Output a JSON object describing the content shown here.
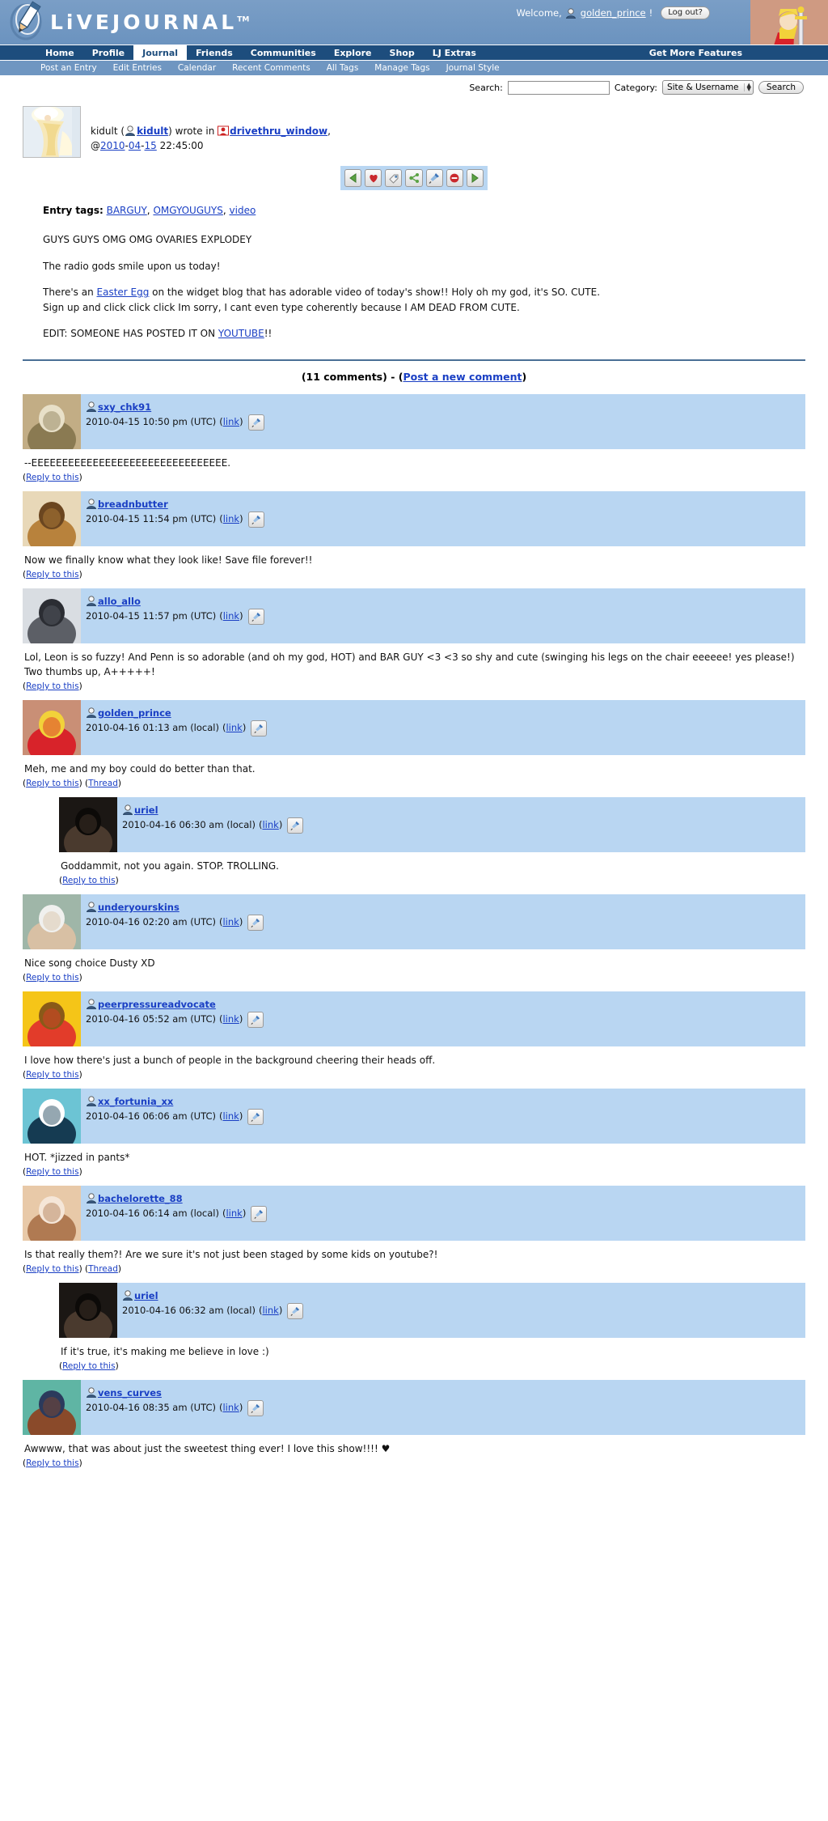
{
  "site": {
    "brand": "LiVEJOURNAL",
    "brand_tm": "TM",
    "logo_icon": "pencil-logo-icon"
  },
  "header": {
    "welcome_prefix": "Welcome,",
    "user_icon": "user-head-icon",
    "username": "golden_prince",
    "welcome_suffix": "!",
    "logout_label": "Log out?",
    "userpic_icon": "sword-in-stone-userpic"
  },
  "nav_main": {
    "items": [
      {
        "label": "Home",
        "active": false
      },
      {
        "label": "Profile",
        "active": false
      },
      {
        "label": "Journal",
        "active": true
      },
      {
        "label": "Friends",
        "active": false
      },
      {
        "label": "Communities",
        "active": false
      },
      {
        "label": "Explore",
        "active": false
      },
      {
        "label": "Shop",
        "active": false
      },
      {
        "label": "LJ Extras",
        "active": false
      }
    ],
    "right_label": "Get More Features"
  },
  "nav_sub": {
    "items": [
      {
        "label": "Post an Entry"
      },
      {
        "label": "Edit Entries"
      },
      {
        "label": "Calendar"
      },
      {
        "label": "Recent Comments"
      },
      {
        "label": "All Tags"
      },
      {
        "label": "Manage Tags"
      },
      {
        "label": "Journal Style"
      }
    ]
  },
  "search": {
    "label": "Search:",
    "value": "",
    "placeholder": "",
    "category_label": "Category:",
    "category_value": "Site & Username",
    "category_options": [
      "Site & Username"
    ],
    "button_label": "Search"
  },
  "entry": {
    "author_plain": "kidult",
    "author_open_paren": "(",
    "author_link": "kidult",
    "author_close_paren": ")",
    "wrote_in": "wrote in",
    "community": "drivethru_window",
    "comma": ",",
    "at_sign": "@",
    "date_year": "2010",
    "date_sep1": "-",
    "date_month": "04",
    "date_sep2": "-",
    "date_day": "15",
    "time": "22:45:00",
    "userpic_icon": "blonde-woman-userpic",
    "community_icon": "community-icon",
    "user_icon": "user-head-icon",
    "toolbar": [
      {
        "name": "previous-entry-button",
        "icon": "left-triangle-icon"
      },
      {
        "name": "add-to-memories-button",
        "icon": "heart-icon"
      },
      {
        "name": "tag-button",
        "icon": "tag-icon"
      },
      {
        "name": "share-button",
        "icon": "share-icon"
      },
      {
        "name": "edit-entry-button",
        "icon": "pin-edit-icon"
      },
      {
        "name": "block-button",
        "icon": "no-entry-icon"
      },
      {
        "name": "next-entry-button",
        "icon": "right-triangle-icon"
      }
    ],
    "tags_label": "Entry tags:",
    "tags": [
      "BARGUY",
      "OMGYOUGUYS",
      "video"
    ],
    "paragraphs": [
      {
        "parts": [
          {
            "t": "GUYS GUYS OMG OMG OVARIES EXPLODEY"
          }
        ]
      },
      {
        "parts": [
          {
            "t": "The radio gods smile upon us today!"
          }
        ]
      },
      {
        "parts": [
          {
            "t": "There's an "
          },
          {
            "t": "Easter Egg",
            "link": true
          },
          {
            "t": " on the widget blog that has adorable video of today's show!! Holy oh my god, it's SO. CUTE."
          },
          {
            "br": true
          },
          {
            "t": "Sign up and click click click Im sorry, I cant even type coherently because I AM DEAD FROM CUTE."
          }
        ]
      },
      {
        "parts": [
          {
            "t": "EDIT: SOMEONE HAS POSTED IT ON "
          },
          {
            "t": "YOUTUBE",
            "link": true
          },
          {
            "t": "!!"
          }
        ]
      }
    ]
  },
  "comments_header": {
    "count_text": "(11 comments)",
    "separator": "-",
    "post_open": "(",
    "post_label": "Post a new comment",
    "post_close": ")"
  },
  "comments": [
    {
      "level": 1,
      "username": "sxy_chk91",
      "date": "2010-04-15 10:50 pm (UTC)",
      "link_open": "(",
      "link_label": "link",
      "link_close": ")",
      "pin_icon": "pin-edit-icon",
      "userpic_icon": "medieval-woman-river-userpic",
      "userpic_colors": [
        "#c2ad85",
        "#8a7a52",
        "#e8e0c8"
      ],
      "body": "--EEEEEEEEEEEEEEEEEEEEEEEEEEEEEEEE.",
      "links": [
        {
          "open": "(",
          "label": "Reply to this",
          "close": ")"
        }
      ]
    },
    {
      "level": 1,
      "username": "breadnbutter",
      "date": "2010-04-15 11:54 pm (UTC)",
      "link_open": "(",
      "link_label": "link",
      "link_close": ")",
      "pin_icon": "pin-edit-icon",
      "userpic_icon": "bread-loaf-userpic",
      "userpic_colors": [
        "#e8d8b8",
        "#b8823c",
        "#6b4620"
      ],
      "body": "Now we finally know what they look like! Save file forever!!",
      "links": [
        {
          "open": "(",
          "label": "Reply to this",
          "close": ")"
        }
      ]
    },
    {
      "level": 1,
      "username": "allo_allo",
      "date": "2010-04-15 11:57 pm (UTC)",
      "link_open": "(",
      "link_label": "link",
      "link_close": ")",
      "pin_icon": "pin-edit-icon",
      "userpic_icon": "group-photo-userpic",
      "userpic_colors": [
        "#d9dde2",
        "#5c5f66",
        "#2b2d33"
      ],
      "body": "Lol, Leon is so fuzzy! And Penn is so adorable (and oh my god, HOT) and BAR GUY <3 <3 so shy and cute (swinging his legs on the chair eeeeee! yes please!) Two thumbs up, A+++++!",
      "links": [
        {
          "open": "(",
          "label": "Reply to this",
          "close": ")"
        }
      ]
    },
    {
      "level": 1,
      "username": "golden_prince",
      "date": "2010-04-16 01:13 am (local)",
      "link_open": "(",
      "link_label": "link",
      "link_close": ")",
      "pin_icon": "pin-edit-icon",
      "userpic_icon": "sword-in-stone-userpic",
      "userpic_colors": [
        "#c98f76",
        "#d8232a",
        "#f2d23a"
      ],
      "body": "Meh, me and my boy could do better than that.",
      "links": [
        {
          "open": "(",
          "label": "Reply to this",
          "close": ")"
        },
        {
          "open": "(",
          "label": "Thread",
          "close": ")"
        }
      ]
    },
    {
      "level": 2,
      "username": "uriel",
      "date": "2010-04-16 06:30 am (local)",
      "link_open": "(",
      "link_label": "link",
      "link_close": ")",
      "pin_icon": "pin-edit-icon",
      "userpic_icon": "man-suit-dark-userpic",
      "userpic_colors": [
        "#1b1714",
        "#4a3a2e",
        "#0c0a08"
      ],
      "body": "Goddammit, not you again. STOP. TROLLING.",
      "links": [
        {
          "open": "(",
          "label": "Reply to this",
          "close": ")"
        }
      ]
    },
    {
      "level": 1,
      "username": "underyourskins",
      "date": "2010-04-16 02:20 am (UTC)",
      "link_open": "(",
      "link_label": "link",
      "link_close": ")",
      "pin_icon": "pin-edit-icon",
      "userpic_icon": "smiling-man-userpic",
      "userpic_colors": [
        "#9fb6a8",
        "#d8c0a4",
        "#f0f0ee"
      ],
      "body": "Nice song choice Dusty XD",
      "links": [
        {
          "open": "(",
          "label": "Reply to this",
          "close": ")"
        }
      ]
    },
    {
      "level": 1,
      "username": "peerpressureadvocate",
      "date": "2010-04-16 05:52 am (UTC)",
      "link_open": "(",
      "link_label": "link",
      "link_close": ")",
      "pin_icon": "pin-edit-icon",
      "userpic_icon": "glee-logo-userpic",
      "userpic_colors": [
        "#f5c518",
        "#e23c2a",
        "#8a5a18"
      ],
      "body": "I love how there's just a bunch of people in the background cheering their heads off.",
      "links": [
        {
          "open": "(",
          "label": "Reply to this",
          "close": ")"
        }
      ]
    },
    {
      "level": 1,
      "username": "xx_fortunia_xx",
      "date": "2010-04-16 06:06 am (UTC)",
      "link_open": "(",
      "link_label": "link",
      "link_close": ")",
      "pin_icon": "pin-edit-icon",
      "userpic_icon": "theyre-just-jealous-userpic",
      "userpic_colors": [
        "#6cc4d4",
        "#153b52",
        "#ffffff"
      ],
      "body": "HOT. *jizzed in pants*",
      "links": [
        {
          "open": "(",
          "label": "Reply to this",
          "close": ")"
        }
      ]
    },
    {
      "level": 1,
      "username": "bachelorette_88",
      "date": "2010-04-16 06:14 am (local)",
      "link_open": "(",
      "link_label": "link",
      "link_close": ")",
      "pin_icon": "pin-edit-icon",
      "userpic_icon": "couple-embrace-userpic",
      "userpic_colors": [
        "#e8c9a8",
        "#b07a52",
        "#f5e6d8"
      ],
      "body": "Is that really them?! Are we sure it's not just been staged by some kids on youtube?!",
      "links": [
        {
          "open": "(",
          "label": "Reply to this",
          "close": ")"
        },
        {
          "open": "(",
          "label": "Thread",
          "close": ")"
        }
      ]
    },
    {
      "level": 2,
      "username": "uriel",
      "date": "2010-04-16 06:32 am (local)",
      "link_open": "(",
      "link_label": "link",
      "link_close": ")",
      "pin_icon": "pin-edit-icon",
      "userpic_icon": "man-suit-dark-userpic",
      "userpic_colors": [
        "#1b1714",
        "#4a3a2e",
        "#0c0a08"
      ],
      "body": "If it's true, it's making me believe in love :)",
      "links": [
        {
          "open": "(",
          "label": "Reply to this",
          "close": ")"
        }
      ]
    },
    {
      "level": 1,
      "username": "vens_curves",
      "date": "2010-04-16 08:35 am (UTC)",
      "link_open": "(",
      "link_label": "link",
      "link_close": ")",
      "pin_icon": "pin-edit-icon",
      "userpic_icon": "laughing-woman-teal-userpic",
      "userpic_colors": [
        "#5fb5a4",
        "#8a4a2a",
        "#2b3a5c"
      ],
      "body": "Awwww, that was about just the sweetest thing ever! I love this show!!!! ♥",
      "links": [
        {
          "open": "(",
          "label": "Reply to this",
          "close": ")"
        }
      ]
    }
  ],
  "colors": {
    "header_blue": "#6f96c1",
    "nav_dark": "#1d4d7d",
    "comment_bg": "#b9d6f2",
    "link": "#1a3fc4",
    "rule": "#4a6f95"
  }
}
